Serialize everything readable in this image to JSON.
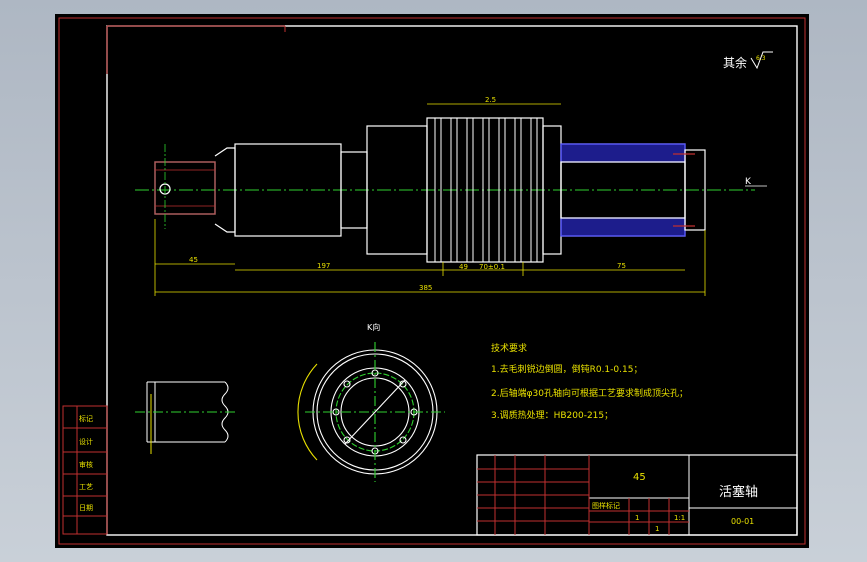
{
  "colors": {
    "outline": "#ffffff",
    "centerline": "#2fd12f",
    "dimension": "#e8e000",
    "section": "#3434ff",
    "hatch": "#5050ff",
    "frame": "#c03030"
  },
  "roughness": {
    "label": "其余",
    "value": "6.3"
  },
  "section_marker": {
    "label": "K"
  },
  "section_view": {
    "label": "K向"
  },
  "tech_requirements": {
    "title": "技术要求",
    "items": [
      "1.去毛刺锐边倒圆，倒钝R0.1-0.15；",
      "2.后轴端φ30孔轴向可根据工艺要求制成顶尖孔；",
      "3.调质热处理：HB200-215；"
    ]
  },
  "dimensions": {
    "total": "385",
    "left": "45",
    "mid": "197",
    "right": "75",
    "inner1": "49",
    "inner2": "70±0.1",
    "slot": "2.5"
  },
  "title_block": {
    "material": "45",
    "part_name": "活塞轴",
    "drawing_no": "00-01",
    "scale": "1:1",
    "sheet": "1",
    "stage_label": "图样标记",
    "qty": "1"
  },
  "left_strip": [
    "标记",
    "设计",
    "审核",
    "工艺",
    "日期"
  ],
  "window_title": ""
}
